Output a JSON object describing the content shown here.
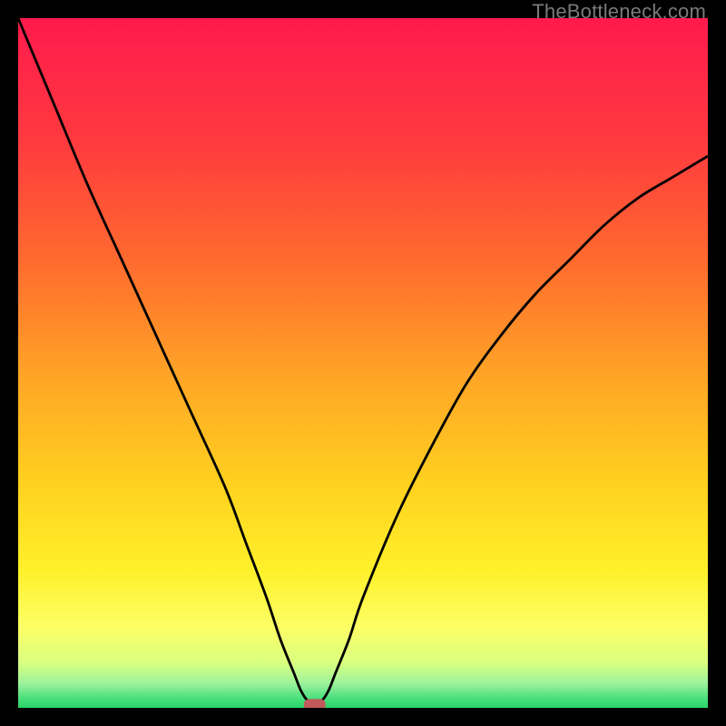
{
  "watermark": "TheBottleneck.com",
  "chart_data": {
    "type": "line",
    "title": "",
    "xlabel": "",
    "ylabel": "",
    "xlim": [
      0,
      100
    ],
    "ylim": [
      0,
      100
    ],
    "series": [
      {
        "name": "curve",
        "x": [
          0,
          5,
          10,
          15,
          20,
          25,
          30,
          33,
          36,
          38,
          40,
          41,
          42,
          43,
          44,
          45,
          46,
          48,
          50,
          55,
          60,
          65,
          70,
          75,
          80,
          85,
          90,
          95,
          100
        ],
        "y": [
          100,
          88,
          76,
          65,
          54,
          43,
          32,
          24,
          16,
          10,
          5,
          2.5,
          1,
          0.5,
          1,
          2.5,
          5,
          10,
          16,
          28,
          38,
          47,
          54,
          60,
          65,
          70,
          74,
          77,
          80
        ]
      }
    ],
    "background": {
      "gradient_stops": [
        {
          "pos": 0.0,
          "color": "#ff1a4d"
        },
        {
          "pos": 0.18,
          "color": "#ff3a3f"
        },
        {
          "pos": 0.35,
          "color": "#ff6a2f"
        },
        {
          "pos": 0.52,
          "color": "#ffa526"
        },
        {
          "pos": 0.68,
          "color": "#ffd21f"
        },
        {
          "pos": 0.8,
          "color": "#fff02a"
        },
        {
          "pos": 0.885,
          "color": "#fcff66"
        },
        {
          "pos": 0.935,
          "color": "#d8ff80"
        },
        {
          "pos": 0.965,
          "color": "#9cf29c"
        },
        {
          "pos": 0.985,
          "color": "#4ee07f"
        },
        {
          "pos": 1.0,
          "color": "#28d468"
        }
      ]
    },
    "marker": {
      "x": 43,
      "y": 0.5,
      "color": "#c25a5a"
    }
  }
}
